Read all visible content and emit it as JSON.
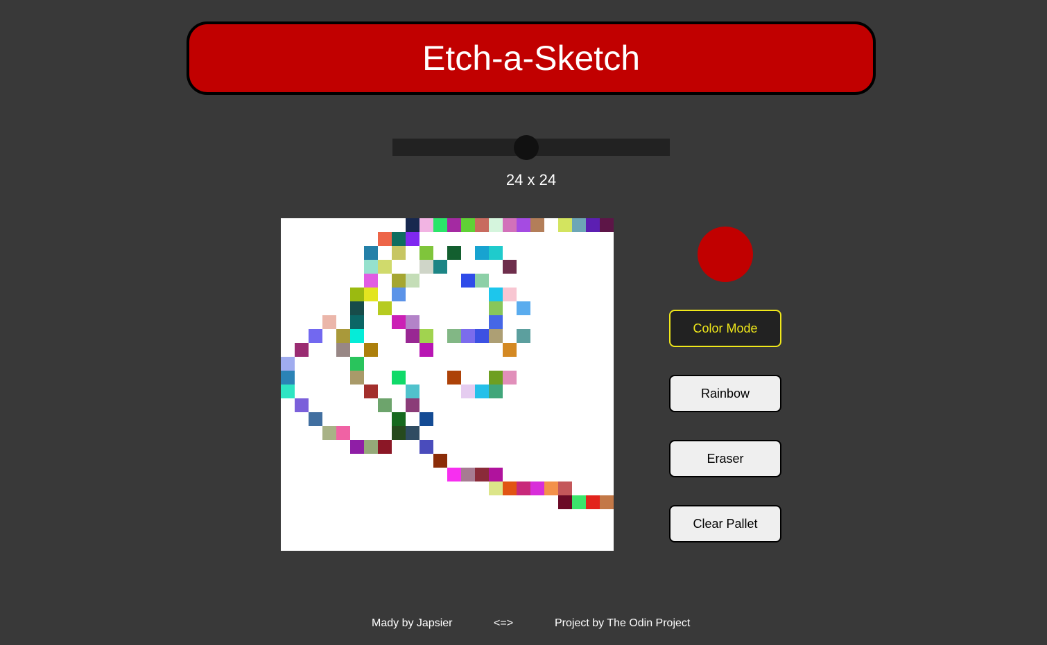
{
  "header": {
    "title": "Etch-a-Sketch"
  },
  "slider": {
    "value": 24,
    "min": 1,
    "max": 100
  },
  "grid_size_label": "24 x 24",
  "grid": {
    "size": 24,
    "cells": [
      [
        0,
        9,
        "#17284f"
      ],
      [
        0,
        10,
        "#f2b4e3"
      ],
      [
        0,
        11,
        "#2be56a"
      ],
      [
        0,
        12,
        "#a42aa2"
      ],
      [
        0,
        13,
        "#60d135"
      ],
      [
        0,
        14,
        "#c86b5f"
      ],
      [
        0,
        15,
        "#d5f5dd"
      ],
      [
        0,
        16,
        "#d271ba"
      ],
      [
        0,
        17,
        "#a54be2"
      ],
      [
        0,
        18,
        "#b37e59"
      ],
      [
        0,
        20,
        "#d3e45f"
      ],
      [
        0,
        21,
        "#6da6b6"
      ],
      [
        0,
        22,
        "#5c1fb2"
      ],
      [
        0,
        23,
        "#5d1547"
      ],
      [
        1,
        7,
        "#ed6548"
      ],
      [
        1,
        8,
        "#0f6d5f"
      ],
      [
        1,
        9,
        "#7f28f0"
      ],
      [
        2,
        6,
        "#2480a8"
      ],
      [
        2,
        8,
        "#c7c663"
      ],
      [
        2,
        10,
        "#7fc53b"
      ],
      [
        2,
        12,
        "#135f2f"
      ],
      [
        2,
        14,
        "#18a3d0"
      ],
      [
        2,
        15,
        "#1fcbcc"
      ],
      [
        3,
        6,
        "#95e1cd"
      ],
      [
        3,
        7,
        "#d0da6c"
      ],
      [
        3,
        10,
        "#cfd5c8"
      ],
      [
        3,
        11,
        "#1c8585"
      ],
      [
        3,
        16,
        "#6e2e4c"
      ],
      [
        4,
        6,
        "#e15de3"
      ],
      [
        4,
        8,
        "#a5a631"
      ],
      [
        4,
        9,
        "#c4ddb7"
      ],
      [
        4,
        13,
        "#2f4ce9"
      ],
      [
        4,
        14,
        "#8dd0a7"
      ],
      [
        5,
        5,
        "#9bba10"
      ],
      [
        5,
        6,
        "#e3e520"
      ],
      [
        5,
        8,
        "#5b93e8"
      ],
      [
        5,
        15,
        "#1dc6ec"
      ],
      [
        5,
        16,
        "#f8c6d2"
      ],
      [
        6,
        5,
        "#174c4a"
      ],
      [
        6,
        7,
        "#b6cb20"
      ],
      [
        6,
        15,
        "#88c65a"
      ],
      [
        6,
        17,
        "#5aacee"
      ],
      [
        7,
        3,
        "#ebb6aa"
      ],
      [
        7,
        5,
        "#0b6665"
      ],
      [
        7,
        8,
        "#cb20b5"
      ],
      [
        7,
        9,
        "#b383c8"
      ],
      [
        7,
        15,
        "#4667e6"
      ],
      [
        8,
        2,
        "#7268f0"
      ],
      [
        8,
        4,
        "#a9993a"
      ],
      [
        8,
        5,
        "#05ecd8"
      ],
      [
        8,
        9,
        "#992793"
      ],
      [
        8,
        10,
        "#a1d34f"
      ],
      [
        8,
        12,
        "#82b785"
      ],
      [
        8,
        13,
        "#7b6ced"
      ],
      [
        8,
        14,
        "#3c51e3"
      ],
      [
        8,
        15,
        "#ad9f74"
      ],
      [
        8,
        17,
        "#5c9f9e"
      ],
      [
        9,
        1,
        "#9a2c72"
      ],
      [
        9,
        4,
        "#988785"
      ],
      [
        9,
        6,
        "#ac7f0c"
      ],
      [
        9,
        10,
        "#b816b3"
      ],
      [
        9,
        16,
        "#d48923"
      ],
      [
        10,
        0,
        "#a0acef"
      ],
      [
        10,
        5,
        "#29c45c"
      ],
      [
        11,
        0,
        "#2b83b6"
      ],
      [
        11,
        5,
        "#a99a69"
      ],
      [
        11,
        8,
        "#10da69"
      ],
      [
        11,
        12,
        "#ad4208"
      ],
      [
        11,
        15,
        "#6e9f21"
      ],
      [
        11,
        16,
        "#e18fba"
      ],
      [
        12,
        0,
        "#2ee5c3"
      ],
      [
        12,
        6,
        "#a32f2c"
      ],
      [
        12,
        9,
        "#50c2cc"
      ],
      [
        12,
        13,
        "#e5ccf0"
      ],
      [
        12,
        14,
        "#25c0e9"
      ],
      [
        12,
        15,
        "#40a67a"
      ],
      [
        13,
        1,
        "#7b60da"
      ],
      [
        13,
        7,
        "#6da46c"
      ],
      [
        13,
        9,
        "#8b3c78"
      ],
      [
        14,
        2,
        "#416fa0"
      ],
      [
        14,
        8,
        "#17691f"
      ],
      [
        14,
        10,
        "#144b94"
      ],
      [
        15,
        3,
        "#a8b286"
      ],
      [
        15,
        4,
        "#f062a4"
      ],
      [
        15,
        8,
        "#264a1d"
      ],
      [
        15,
        9,
        "#2f4c62"
      ],
      [
        16,
        5,
        "#8f1ea6"
      ],
      [
        16,
        6,
        "#95a979"
      ],
      [
        16,
        7,
        "#8b1726"
      ],
      [
        16,
        10,
        "#4a4cbc"
      ],
      [
        17,
        11,
        "#8b2c08"
      ],
      [
        18,
        12,
        "#f72ff0"
      ],
      [
        18,
        13,
        "#a77b92"
      ],
      [
        18,
        14,
        "#8a2b39"
      ],
      [
        18,
        15,
        "#b0129d"
      ],
      [
        19,
        15,
        "#dce589"
      ],
      [
        19,
        16,
        "#e15413"
      ],
      [
        19,
        17,
        "#c8287a"
      ],
      [
        19,
        18,
        "#d82dd9"
      ],
      [
        19,
        19,
        "#f3914a"
      ],
      [
        19,
        20,
        "#c4575a"
      ],
      [
        20,
        20,
        "#6b0a26"
      ],
      [
        20,
        21,
        "#3ce56b"
      ],
      [
        20,
        22,
        "#e2241c"
      ],
      [
        20,
        23,
        "#c37847"
      ]
    ]
  },
  "current_color": "#c10000",
  "buttons": {
    "color_mode": "Color Mode",
    "rainbow": "Rainbow",
    "eraser": "Eraser",
    "clear": "Clear Pallet"
  },
  "footer": {
    "made_by": "Mady by Japsier",
    "separator": "<=>",
    "project_by": "Project by The Odin Project"
  }
}
